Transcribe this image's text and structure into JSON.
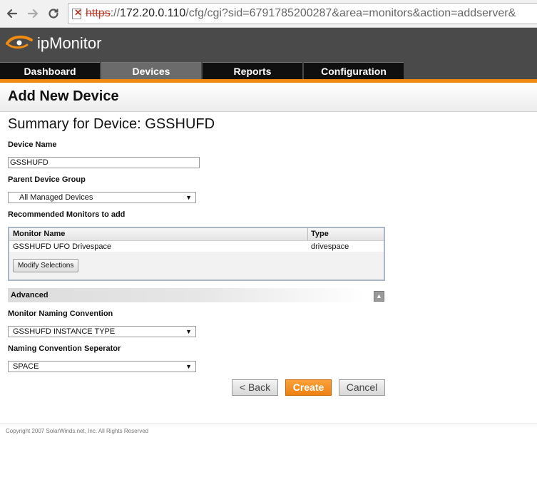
{
  "browser": {
    "url_scheme": "https",
    "url_host": "172.20.0.110",
    "url_rest": "/cfg/cgi?sid=6791785200287&area=monitors&action=addserver&"
  },
  "app": {
    "name": "ipMonitor",
    "tabs": [
      {
        "label": "Dashboard"
      },
      {
        "label": "Devices"
      },
      {
        "label": "Reports"
      },
      {
        "label": "Configuration"
      }
    ],
    "accent_color": "#f08a10"
  },
  "page": {
    "title": "Add New Device",
    "summary": "Summary for Device: GSSHUFD"
  },
  "form": {
    "device_name_label": "Device Name",
    "device_name_value": "GSSHUFD",
    "parent_group_label": "Parent Device Group",
    "parent_group_value": "All Managed Devices",
    "recommended_label": "Recommended Monitors to add",
    "monitors": {
      "col_name": "Monitor Name",
      "col_type": "Type",
      "rows": [
        {
          "name": "GSSHUFD UFO Drivespace",
          "type": "drivespace"
        }
      ],
      "modify_button": "Modify Selections"
    },
    "advanced_label": "Advanced",
    "naming_convention_label": "Monitor Naming Convention",
    "naming_convention_value": "GSSHUFD INSTANCE TYPE",
    "separator_label": "Naming Convention Seperator",
    "separator_value": "SPACE"
  },
  "actions": {
    "back": "< Back",
    "create": "Create",
    "cancel": "Cancel"
  },
  "footer": {
    "copyright": "Copyright 2007 SolarWinds.net, Inc. All Rights Reserved"
  }
}
